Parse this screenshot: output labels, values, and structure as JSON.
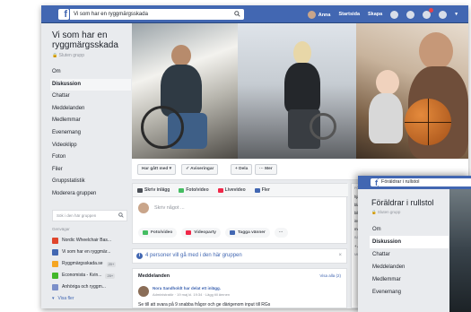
{
  "topbar": {
    "search_value": "Vi som har en ryggmärgsskada",
    "user_name": "Anna",
    "home_label": "Startsida",
    "create_label": "Skapa"
  },
  "group": {
    "name": "Vi som har en ryggmärgsskada",
    "type": "Sluten grupp"
  },
  "nav": {
    "items": [
      {
        "label": "Om"
      },
      {
        "label": "Diskussion"
      },
      {
        "label": "Chattar"
      },
      {
        "label": "Meddelanden"
      },
      {
        "label": "Medlemmar"
      },
      {
        "label": "Evenemang"
      },
      {
        "label": "Videoklipp"
      },
      {
        "label": "Foton"
      },
      {
        "label": "Filer"
      },
      {
        "label": "Gruppstatistik"
      },
      {
        "label": "Moderera gruppen"
      }
    ]
  },
  "group_search_placeholder": "Sök i den här gruppen",
  "shortcuts": {
    "title": "Genvägar",
    "items": [
      {
        "label": "Nordic Wheelchair Bas...",
        "count": "",
        "color": "#e0452c"
      },
      {
        "label": "Vi som har en ryggmär...",
        "count": "",
        "color": "#4267b2"
      },
      {
        "label": "Ryggmärgsskada.se",
        "count": "20+",
        "color": "#f5a623"
      },
      {
        "label": "Economista - Kvin...",
        "count": "20+",
        "color": "#42b72a"
      },
      {
        "label": "Anhöriga och ryggm...",
        "count": "",
        "color": "#7b8fc9"
      }
    ],
    "see_more": "Visa fler"
  },
  "action_bar": {
    "joined": "Har gått med ▾",
    "notifications": "✓ Aviseringar",
    "share": "+ Dela",
    "more": "··· Mer"
  },
  "composer": {
    "tabs": [
      "Skriv inlägg",
      "Foto/video",
      "Livevideo",
      "Fler"
    ],
    "placeholder": "Skriv något ...",
    "actions": [
      "Foto/video",
      "Videoparty",
      "Tagga vänner"
    ],
    "more": "···"
  },
  "join_bar": {
    "text": "4 personer vill gå med i den här gruppen",
    "close": "×"
  },
  "announcements": {
    "title": "Meddelanden",
    "see_all": "Visa alla (2)",
    "author": "Nora Sandholdt har delat ett inlägg.",
    "meta": "Administratör · 19 maj kl. 19:34 · Lägg till ämnen",
    "text": "Se till att svara på 9 snabba frågor och ge därigenom input till RGs"
  },
  "right_col": {
    "head": "FÖRS",
    "lines": [
      "hjälp",
      "blanp",
      "bilkost",
      "inspir",
      "medic"
    ],
    "head2": "BJUD IN",
    "lines2": [
      "+ Ange",
      ""
    ],
    "head3": "MEDLEM"
  },
  "overlay": {
    "search_value": "Föräldrar i rullstol",
    "group_name": "Föräldrar i rullstol",
    "group_type": "Sluten grupp",
    "items": [
      {
        "label": "Om"
      },
      {
        "label": "Diskussion"
      },
      {
        "label": "Chattar"
      },
      {
        "label": "Meddelanden"
      },
      {
        "label": "Medlemmar"
      },
      {
        "label": "Evenemang"
      }
    ]
  },
  "colors": {
    "brand": "#4267b2",
    "background": "#e9ebee"
  }
}
